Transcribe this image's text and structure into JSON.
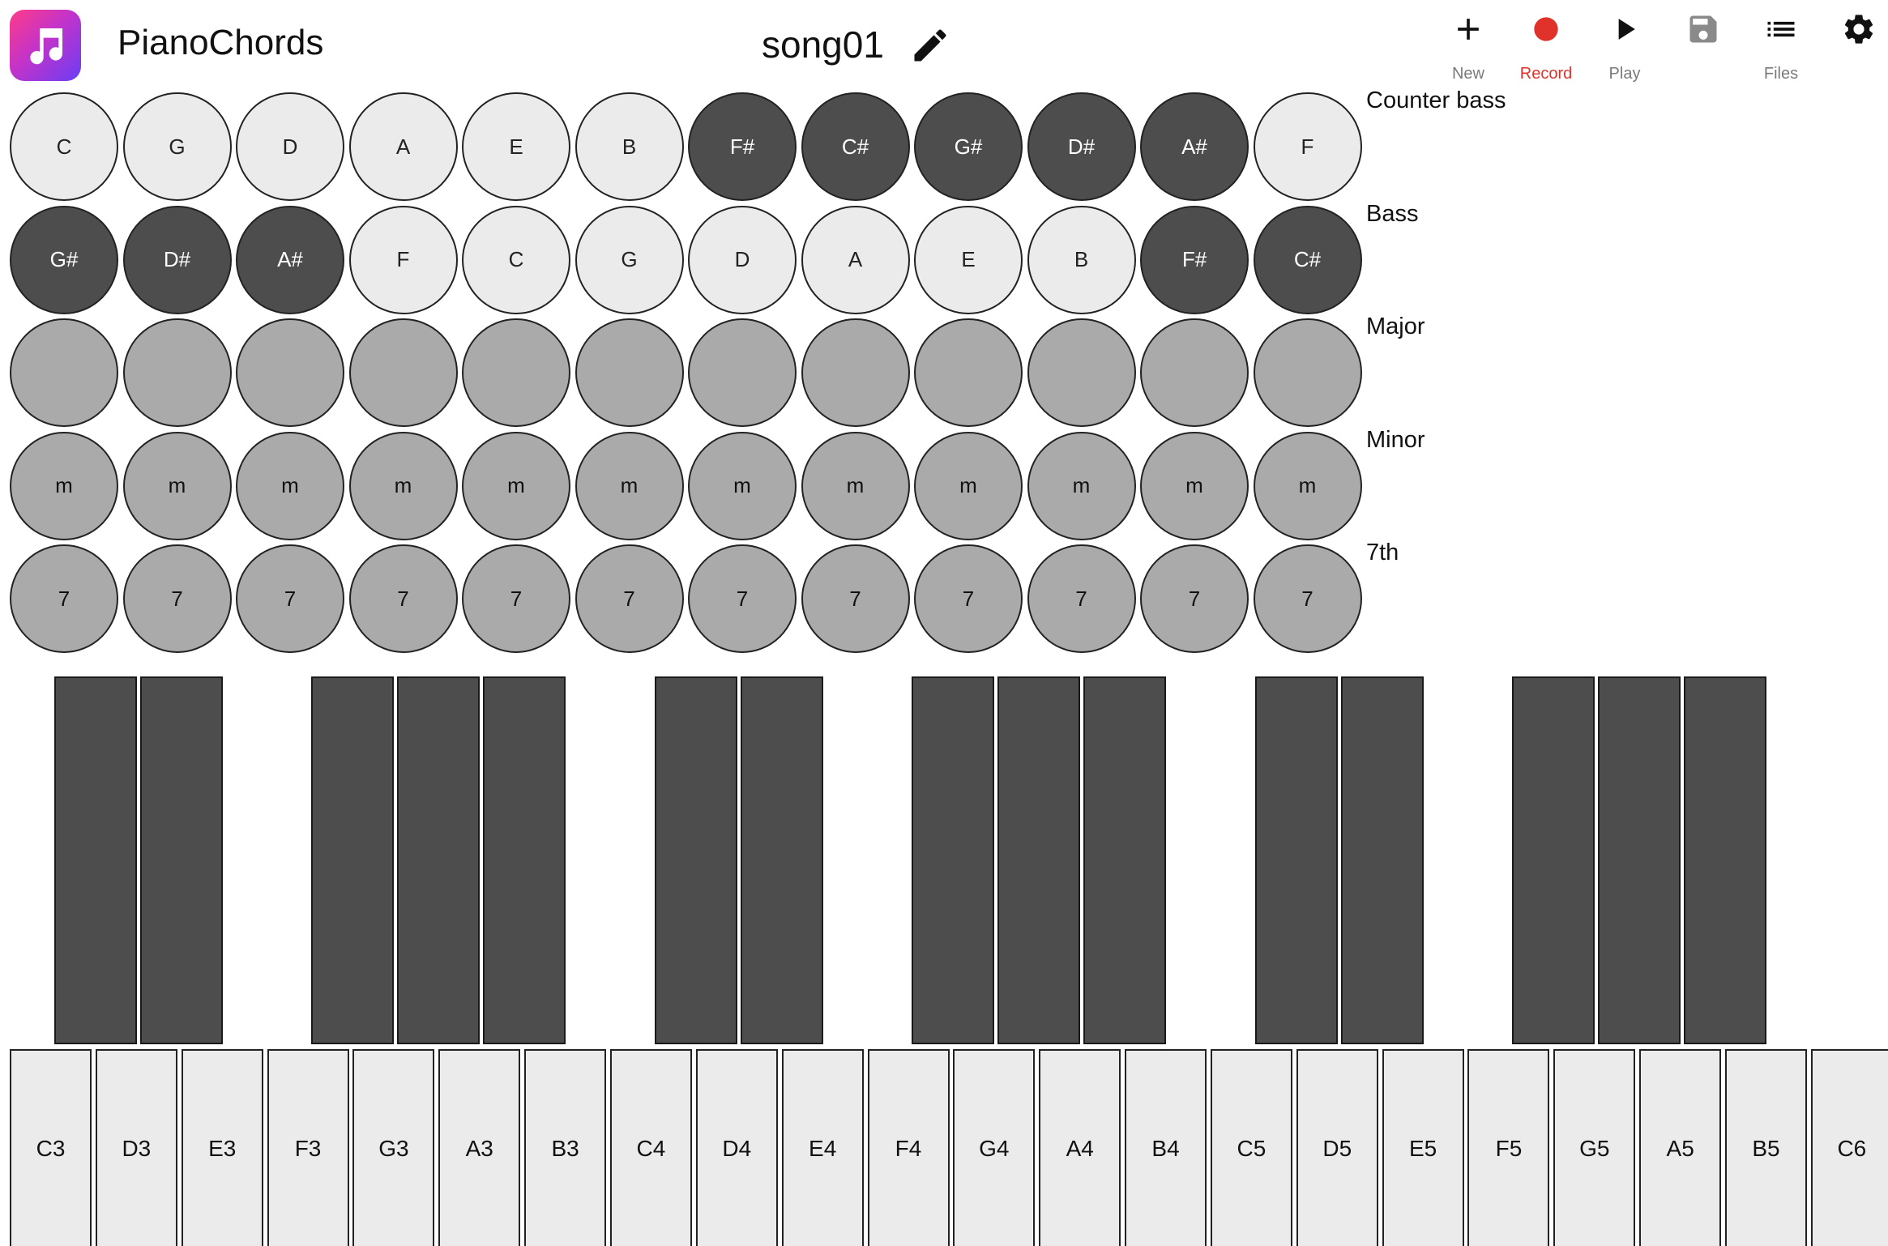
{
  "header": {
    "app_title": "PianoChords",
    "song_title": "song01",
    "toolbar": [
      {
        "id": "new",
        "label": "New",
        "icon": "plus-icon"
      },
      {
        "id": "record",
        "label": "Record",
        "icon": "record-dot-icon",
        "color": "#e0322b"
      },
      {
        "id": "play",
        "label": "Play",
        "icon": "play-icon"
      },
      {
        "id": "save",
        "label": "",
        "icon": "floppy-disk-icon",
        "disabled": true
      },
      {
        "id": "files",
        "label": "Files",
        "icon": "list-icon"
      },
      {
        "id": "settings",
        "label": "",
        "icon": "gear-icon"
      }
    ]
  },
  "chord_rows": [
    {
      "label": "Counter bass",
      "buttons": [
        {
          "text": "C",
          "style": "light"
        },
        {
          "text": "G",
          "style": "light"
        },
        {
          "text": "D",
          "style": "light"
        },
        {
          "text": "A",
          "style": "light"
        },
        {
          "text": "E",
          "style": "light"
        },
        {
          "text": "B",
          "style": "light"
        },
        {
          "text": "F#",
          "style": "dark"
        },
        {
          "text": "C#",
          "style": "dark"
        },
        {
          "text": "G#",
          "style": "dark"
        },
        {
          "text": "D#",
          "style": "dark"
        },
        {
          "text": "A#",
          "style": "dark"
        },
        {
          "text": "F",
          "style": "light"
        }
      ]
    },
    {
      "label": "Bass",
      "buttons": [
        {
          "text": "G#",
          "style": "dark"
        },
        {
          "text": "D#",
          "style": "dark"
        },
        {
          "text": "A#",
          "style": "dark"
        },
        {
          "text": "F",
          "style": "light"
        },
        {
          "text": "C",
          "style": "light"
        },
        {
          "text": "G",
          "style": "light"
        },
        {
          "text": "D",
          "style": "light"
        },
        {
          "text": "A",
          "style": "light"
        },
        {
          "text": "E",
          "style": "light"
        },
        {
          "text": "B",
          "style": "light"
        },
        {
          "text": "F#",
          "style": "dark"
        },
        {
          "text": "C#",
          "style": "dark"
        }
      ]
    },
    {
      "label": "Major",
      "buttons": [
        {
          "text": "",
          "style": "gray"
        },
        {
          "text": "",
          "style": "gray"
        },
        {
          "text": "",
          "style": "gray"
        },
        {
          "text": "",
          "style": "gray"
        },
        {
          "text": "",
          "style": "gray"
        },
        {
          "text": "",
          "style": "gray"
        },
        {
          "text": "",
          "style": "gray"
        },
        {
          "text": "",
          "style": "gray"
        },
        {
          "text": "",
          "style": "gray"
        },
        {
          "text": "",
          "style": "gray"
        },
        {
          "text": "",
          "style": "gray"
        },
        {
          "text": "",
          "style": "gray"
        }
      ]
    },
    {
      "label": "Minor",
      "buttons": [
        {
          "text": "m",
          "style": "gray"
        },
        {
          "text": "m",
          "style": "gray"
        },
        {
          "text": "m",
          "style": "gray"
        },
        {
          "text": "m",
          "style": "gray"
        },
        {
          "text": "m",
          "style": "gray"
        },
        {
          "text": "m",
          "style": "gray"
        },
        {
          "text": "m",
          "style": "gray"
        },
        {
          "text": "m",
          "style": "gray"
        },
        {
          "text": "m",
          "style": "gray"
        },
        {
          "text": "m",
          "style": "gray"
        },
        {
          "text": "m",
          "style": "gray"
        },
        {
          "text": "m",
          "style": "gray"
        }
      ]
    },
    {
      "label": "7th",
      "buttons": [
        {
          "text": "7",
          "style": "gray"
        },
        {
          "text": "7",
          "style": "gray"
        },
        {
          "text": "7",
          "style": "gray"
        },
        {
          "text": "7",
          "style": "gray"
        },
        {
          "text": "7",
          "style": "gray"
        },
        {
          "text": "7",
          "style": "gray"
        },
        {
          "text": "7",
          "style": "gray"
        },
        {
          "text": "7",
          "style": "gray"
        },
        {
          "text": "7",
          "style": "gray"
        },
        {
          "text": "7",
          "style": "gray"
        },
        {
          "text": "7",
          "style": "gray"
        },
        {
          "text": "7",
          "style": "gray"
        }
      ]
    }
  ],
  "piano": {
    "white_keys": [
      "C3",
      "D3",
      "E3",
      "F3",
      "G3",
      "A3",
      "B3",
      "C4",
      "D4",
      "E4",
      "F4",
      "G4",
      "A4",
      "B4",
      "C5",
      "D5",
      "E5",
      "F5",
      "G5",
      "A5",
      "B5",
      "C6"
    ]
  },
  "colors": {
    "record": "#e0322b",
    "key_dark": "#4d4d4d",
    "key_light": "#ebebeb",
    "chord_gray": "#aaaaaa"
  }
}
